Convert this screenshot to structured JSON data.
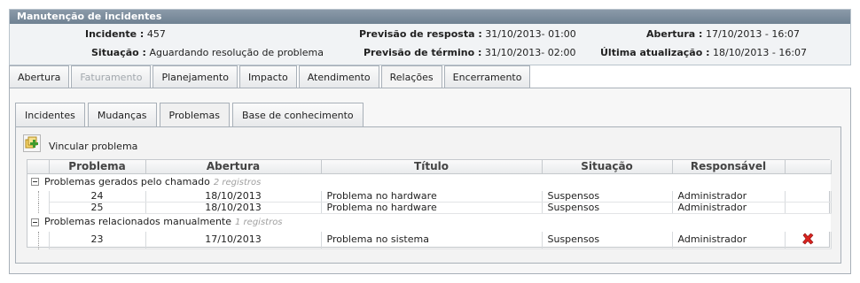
{
  "header": {
    "title": "Manutenção de incidentes",
    "incidente_label": "Incidente :",
    "incidente_value": "457",
    "situacao_label": "Situação :",
    "situacao_value": "Aguardando resolução de problema",
    "prev_resposta_label": "Previsão de resposta :",
    "prev_resposta_value": "31/10/2013- 01:00",
    "prev_termino_label": "Previsão de término :",
    "prev_termino_value": "31/10/2013- 02:00",
    "abertura_label": "Abertura :",
    "abertura_value": "17/10/2013 - 16:07",
    "ultima_label": "Última atualização :",
    "ultima_value": "18/10/2013 - 16:07"
  },
  "tabs": [
    {
      "label": "Abertura"
    },
    {
      "label": "Faturamento"
    },
    {
      "label": "Planejamento"
    },
    {
      "label": "Impacto"
    },
    {
      "label": "Atendimento"
    },
    {
      "label": "Relações"
    },
    {
      "label": "Encerramento"
    }
  ],
  "subtabs": [
    {
      "label": "Incidentes"
    },
    {
      "label": "Mudanças"
    },
    {
      "label": "Problemas"
    },
    {
      "label": "Base de conhecimento"
    }
  ],
  "vincular_label": "Vincular problema",
  "grid": {
    "columns": [
      "Problema",
      "Abertura",
      "Título",
      "Situação",
      "Responsável"
    ],
    "groups": [
      {
        "label": "Problemas gerados pelo chamado",
        "count": "2 registros",
        "rows": [
          {
            "problema": "24",
            "abertura": "18/10/2013",
            "titulo": "Problema no hardware",
            "situacao": "Suspensos",
            "responsavel": "Administrador"
          },
          {
            "problema": "25",
            "abertura": "18/10/2013",
            "titulo": "Problema no hardware",
            "situacao": "Suspensos",
            "responsavel": "Administrador"
          }
        ]
      },
      {
        "label": "Problemas relacionados manualmente",
        "count": "1 registros",
        "rows": [
          {
            "problema": "23",
            "abertura": "17/10/2013",
            "titulo": "Problema no sistema",
            "situacao": "Suspensos",
            "responsavel": "Administrador"
          }
        ]
      }
    ]
  },
  "colors": {
    "header_bar": "#7a8a9a",
    "delete_icon": "#d9231f",
    "add_icon": "#3f9a2e"
  },
  "icons": {
    "add": "add-link-icon",
    "delete": "delete-icon",
    "tree": "collapse-icon"
  }
}
